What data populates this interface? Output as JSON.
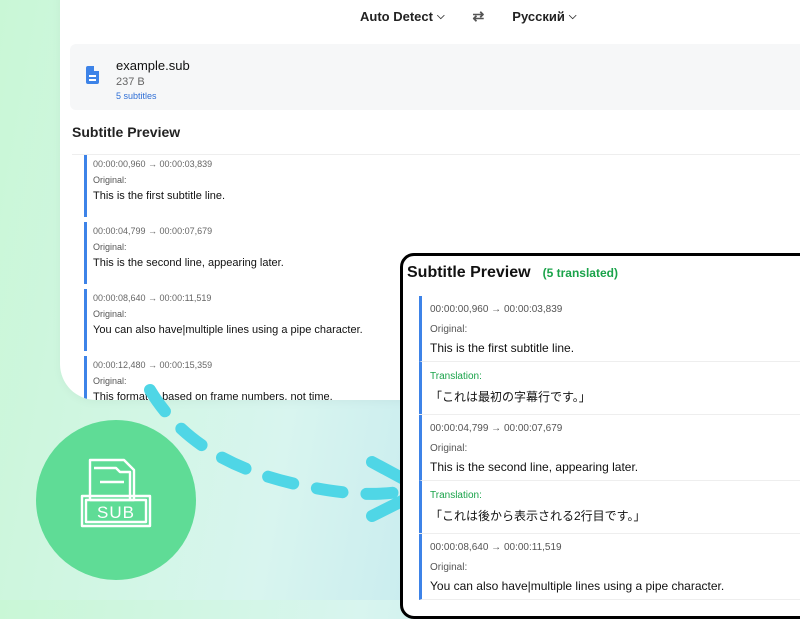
{
  "header": {
    "source_lang": "Auto Detect",
    "target_lang": "Русский",
    "swap_icon": "⇄"
  },
  "file": {
    "name": "example.sub",
    "size": "237 B",
    "subtitle_count": "5 subtitles"
  },
  "preview": {
    "title": "Subtitle Preview",
    "items": [
      {
        "time": "00:00:00,960 → 00:00:03,839",
        "label": "Original:",
        "text": "This is the first subtitle line."
      },
      {
        "time": "00:00:04,799 → 00:00:07,679",
        "label": "Original:",
        "text": "This is the second line, appearing later."
      },
      {
        "time": "00:00:08,640 → 00:00:11,519",
        "label": "Original:",
        "text": "You can also have|multiple lines using a pipe character."
      },
      {
        "time": "00:00:12,480 → 00:00:15,359",
        "label": "Original:",
        "text": "This format is based on frame numbers, not time."
      }
    ]
  },
  "translated_preview": {
    "title": "Subtitle Preview",
    "count": "(5 translated)",
    "items": [
      {
        "time": "00:00:00,960 → 00:00:03,839",
        "label": "Original:",
        "text": "This is the first subtitle line.",
        "trans_label": "Translation:",
        "trans_text": "「これは最初の字幕行です。」"
      },
      {
        "time": "00:00:04,799 → 00:00:07,679",
        "label": "Original:",
        "text": "This is the second line, appearing later.",
        "trans_label": "Translation:",
        "trans_text": "「これは後から表示される2行目です。」"
      },
      {
        "time": "00:00:08,640 → 00:00:11,519",
        "label": "Original:",
        "text": "You can also have|multiple lines using a pipe character."
      }
    ]
  },
  "badge": {
    "label": "SUB",
    "icon": "subtitle-file-icon"
  },
  "colors": {
    "accent": "#3d83e8",
    "translation": "#1aa34a",
    "badge": "#5fdc96",
    "arrow": "#4fd6e6"
  }
}
